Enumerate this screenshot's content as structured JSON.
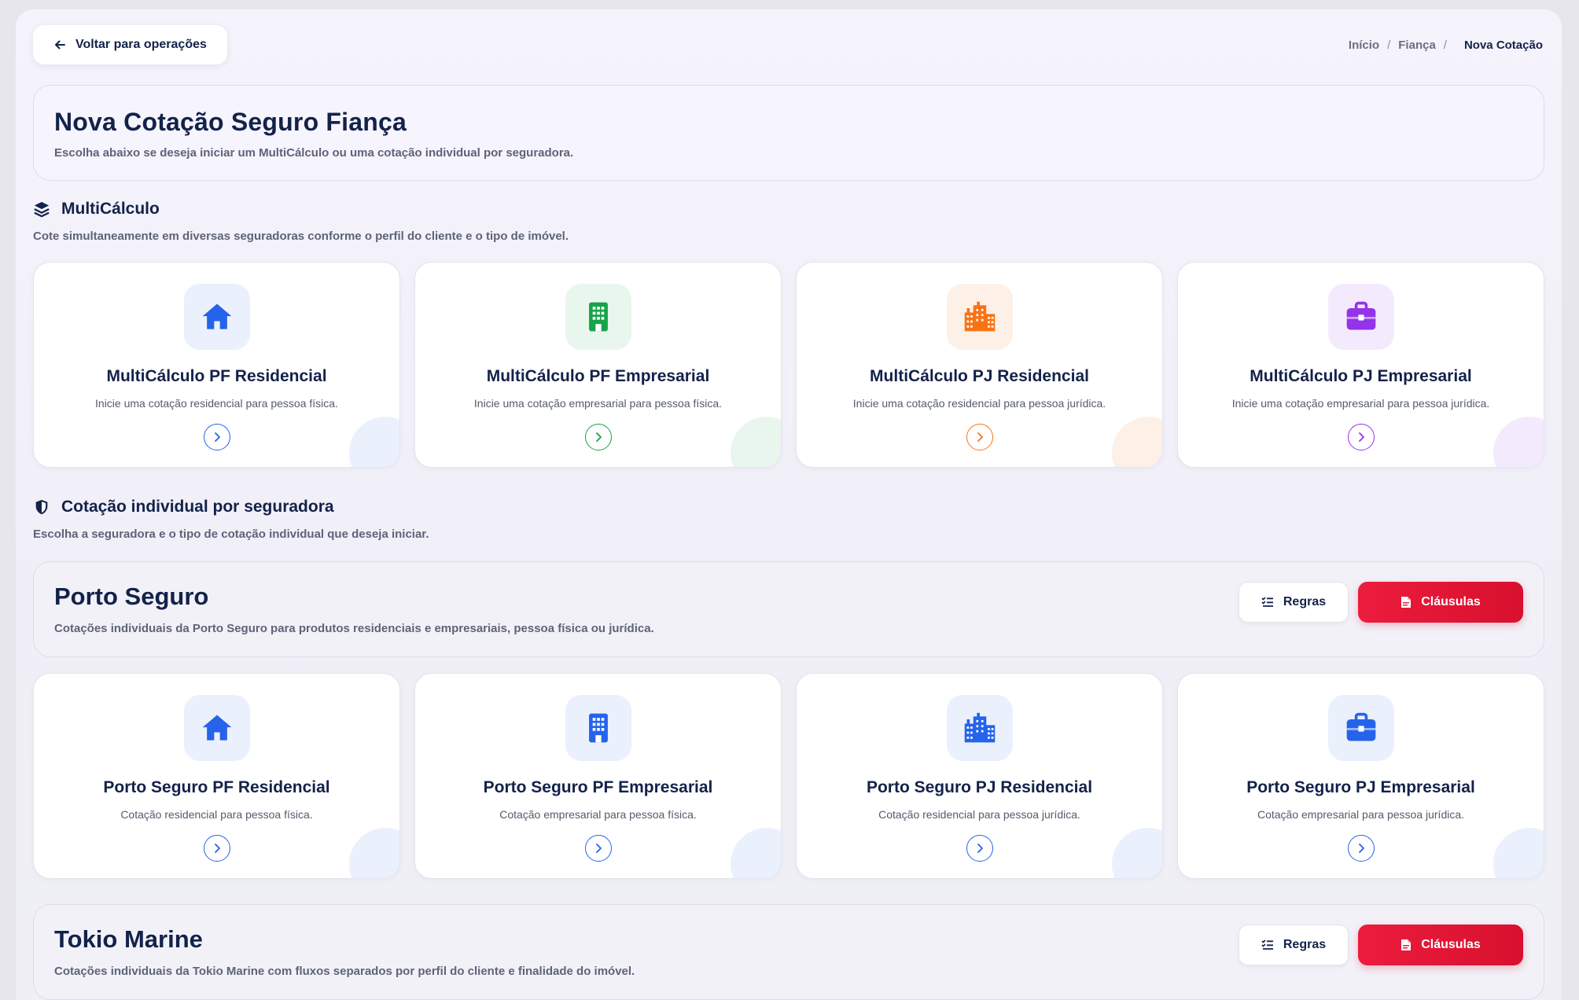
{
  "back_button": {
    "label": "Voltar para operações"
  },
  "breadcrumb": {
    "items": [
      "Início",
      "Fiança"
    ],
    "current": "Nova Cotação"
  },
  "hero": {
    "title": "Nova Cotação Seguro Fiança",
    "subtitle": "Escolha abaixo se deseja iniciar um MultiCálculo ou uma cotação individual por seguradora."
  },
  "multicalculo": {
    "title": "MultiCálculo",
    "subtitle": "Cote simultaneamente em diversas seguradoras conforme o perfil do cliente e o tipo de imóvel.",
    "cards": [
      {
        "title": "MultiCálculo PF Residencial",
        "desc": "Inicie uma cotação residencial para pessoa física.",
        "icon": "house-icon",
        "color": "#2563eb",
        "bg": "#ebf0fd"
      },
      {
        "title": "MultiCálculo PF Empresarial",
        "desc": "Inicie uma cotação empresarial para pessoa física.",
        "icon": "building-icon",
        "color": "#16a34a",
        "bg": "#e9f6ed"
      },
      {
        "title": "MultiCálculo PJ Residencial",
        "desc": "Inicie uma cotação residencial para pessoa jurídica.",
        "icon": "city-icon",
        "color": "#f97316",
        "bg": "#fdf0e7"
      },
      {
        "title": "MultiCálculo PJ Empresarial",
        "desc": "Inicie uma cotação empresarial para pessoa jurídica.",
        "icon": "briefcase-icon",
        "color": "#9333ea",
        "bg": "#f3ebfd"
      }
    ]
  },
  "individual": {
    "title": "Cotação individual por seguradora",
    "subtitle": "Escolha a seguradora e o tipo de cotação individual que deseja iniciar."
  },
  "insurers": [
    {
      "name": "Porto Seguro",
      "desc": "Cotações individuais da Porto Seguro para produtos residenciais e empresariais, pessoa física ou jurídica.",
      "rules_label": "Regras",
      "clauses_label": "Cláusulas",
      "cards": [
        {
          "title": "Porto Seguro PF Residencial",
          "desc": "Cotação residencial para pessoa física.",
          "icon": "house-icon"
        },
        {
          "title": "Porto Seguro PF Empresarial",
          "desc": "Cotação empresarial para pessoa física.",
          "icon": "building-icon"
        },
        {
          "title": "Porto Seguro PJ Residencial",
          "desc": "Cotação residencial para pessoa jurídica.",
          "icon": "city-icon"
        },
        {
          "title": "Porto Seguro PJ Empresarial",
          "desc": "Cotação empresarial para pessoa jurídica.",
          "icon": "briefcase-icon"
        }
      ]
    },
    {
      "name": "Tokio Marine",
      "desc": "Cotações individuais da Tokio Marine com fluxos separados por perfil do cliente e finalidade do imóvel.",
      "rules_label": "Regras",
      "clauses_label": "Cláusulas"
    }
  ],
  "colors": {
    "primary": "#13224a",
    "accent_blue": "#2563eb",
    "danger": "#e11d3c"
  }
}
